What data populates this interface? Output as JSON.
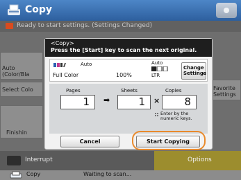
{
  "header": {
    "title": "Copy"
  },
  "status_bar": {
    "message": "Ready to start settings. (Settings Changed)"
  },
  "background": {
    "color_mode": "Auto\n(Color/Bla",
    "select_color": "Select Colo",
    "favorite_settings": "Favorite\nSettings",
    "finishing": "Finishin",
    "interrupt": "Interrupt",
    "options": "Options"
  },
  "bottom_bar": {
    "app": "Copy",
    "status": "Waiting to scan..."
  },
  "dialog": {
    "tag": "<Copy>",
    "message": "Press the [Start] key to scan the next original.",
    "info": {
      "color_auto": "Auto",
      "color_mode": "Full Color",
      "zoom": "100%",
      "paper_auto": "Auto",
      "paper_size": "LTR",
      "change_settings": "Change\nSettings"
    },
    "counts": {
      "pages_label": "Pages",
      "pages": "1",
      "sheets_label": "Sheets",
      "sheets": "1",
      "copies_label": "Copies",
      "copies": "8",
      "hint": "Enter by the\nnumeric keys."
    },
    "cancel_label": "Cancel",
    "start_label": "Start Copying"
  },
  "colors": {
    "header": "#3e74b8",
    "highlight": "#e98a2c",
    "options": "#9c8d2e"
  }
}
